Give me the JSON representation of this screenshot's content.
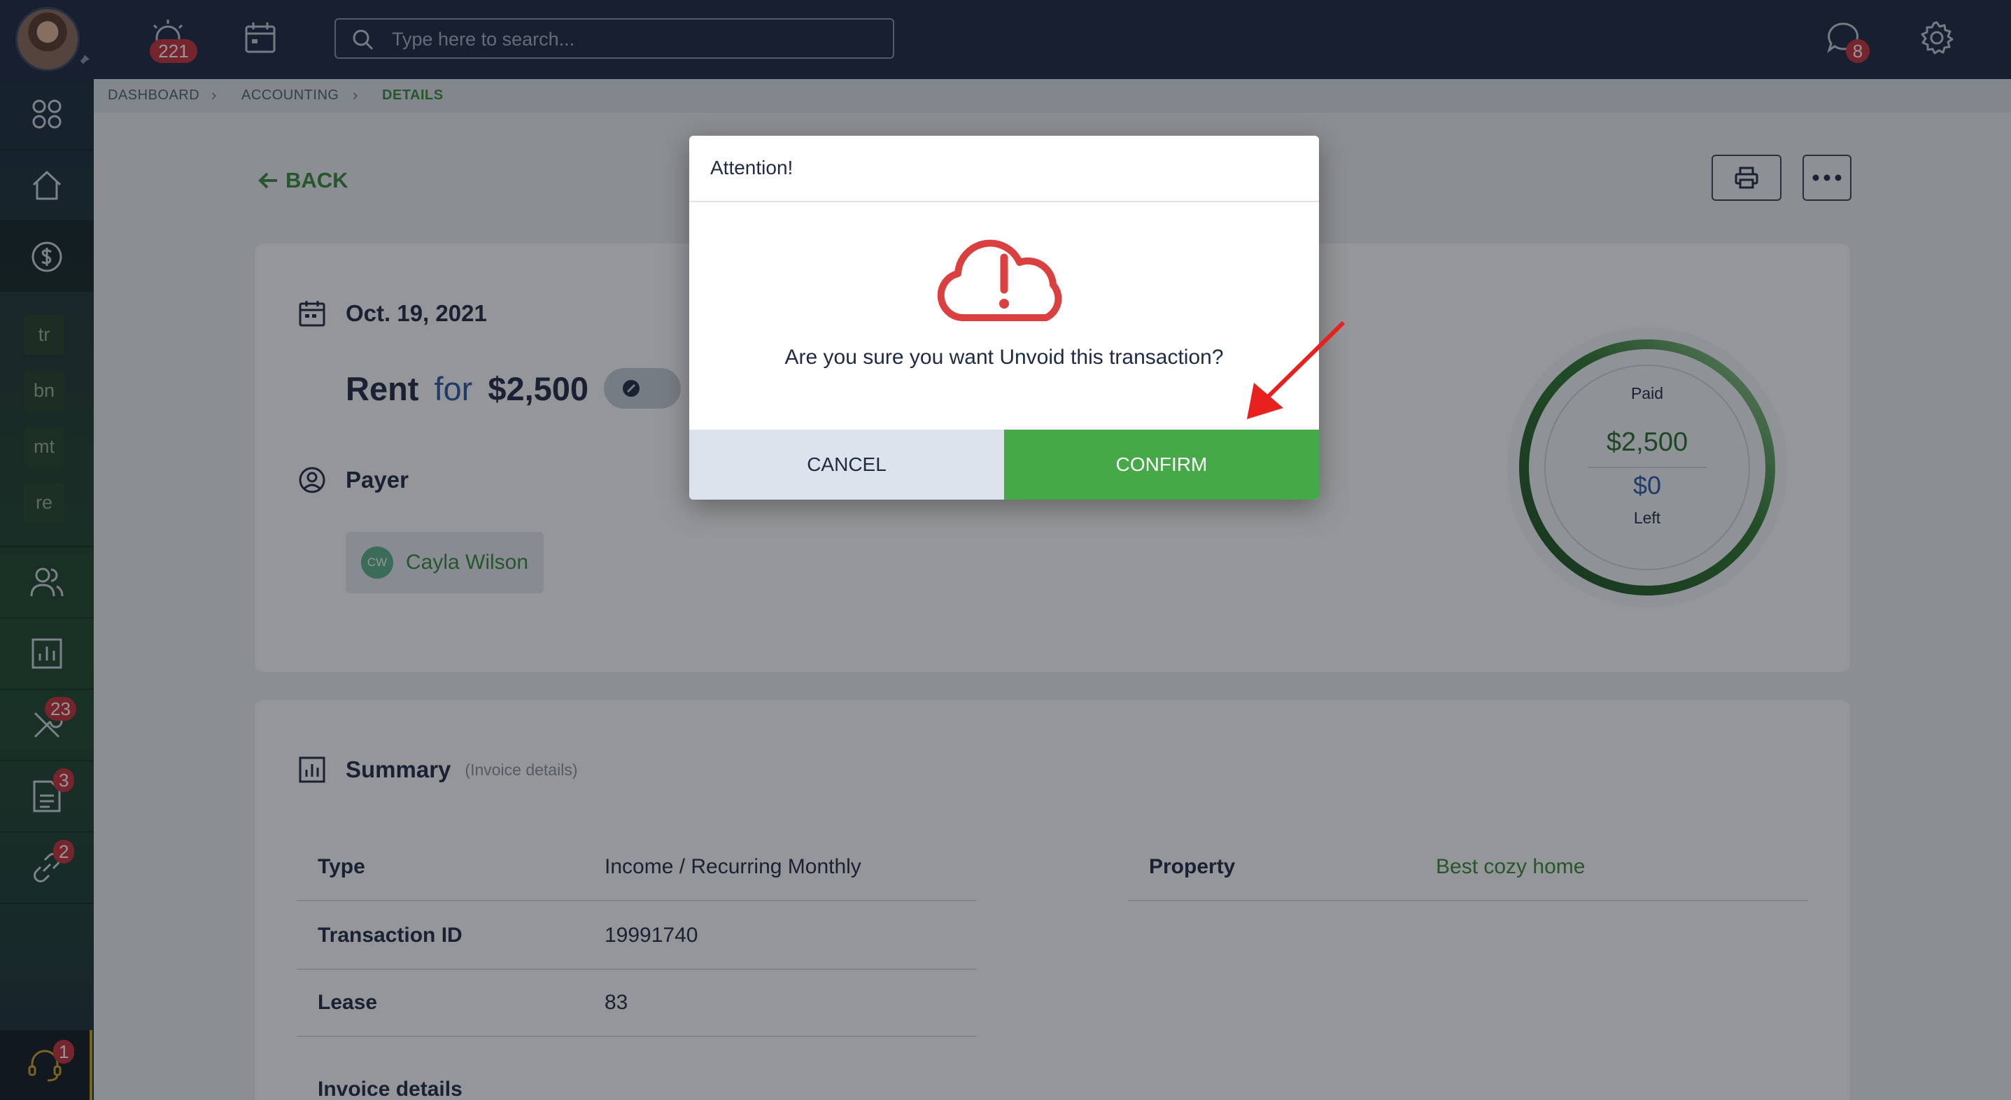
{
  "topbar": {
    "notifications_count": "221",
    "search": {
      "placeholder": "Type here to search..."
    },
    "messages_count": "8"
  },
  "sidebar": {
    "chips": [
      "tr",
      "bn",
      "mt",
      "re"
    ],
    "badges": {
      "maintenance": "23",
      "documents": "3",
      "links": "2",
      "support": "1"
    }
  },
  "breadcrumb": [
    "DASHBOARD",
    "ACCOUNTING",
    "DETAILS"
  ],
  "back_label": "BACK",
  "transaction": {
    "date": "Oct. 19, 2021",
    "category": "Rent",
    "for_label": "for",
    "amount": "$2,500",
    "payer_label": "Payer",
    "payer_initials": "CW",
    "payer_name": "Cayla Wilson"
  },
  "gauge": {
    "paid_label": "Paid",
    "paid_amount": "$2,500",
    "left_amount": "$0",
    "left_label": "Left",
    "paid_fraction": 1.0
  },
  "summary": {
    "title": "Summary",
    "subtitle": "(Invoice details)",
    "rows": [
      {
        "key": "Type",
        "value": "Income / Recurring Monthly"
      },
      {
        "key": "Transaction ID",
        "value": "19991740"
      },
      {
        "key": "Lease",
        "value": "83"
      }
    ],
    "property_key": "Property",
    "property_value": "Best cozy home",
    "invoice_details": "Invoice details"
  },
  "modal": {
    "title": "Attention!",
    "message": "Are you sure you want Unvoid this transaction?",
    "cancel_label": "CANCEL",
    "confirm_label": "CONFIRM"
  },
  "colors": {
    "accent_green": "#44a946",
    "danger_red": "#d9403f",
    "topbar": "#1c2740"
  }
}
